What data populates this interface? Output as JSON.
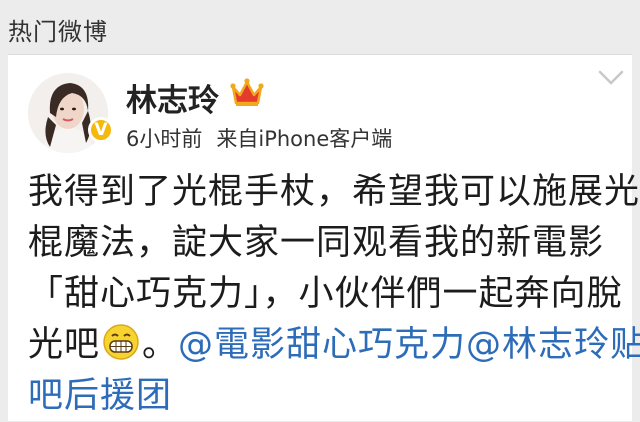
{
  "header": {
    "title": "热门微博"
  },
  "post": {
    "username": "林志玲",
    "verified_badge": "V",
    "time": "6小时前",
    "source": "来自iPhone客户端",
    "content": {
      "line1": "我得到了光棍手杖，希望我可以施展光",
      "line2": "棍魔法，諚大家一同观看我的新電影",
      "line3": "「甜心巧克力」，小伙伴們一起奔向脫",
      "line4_text": "光吧",
      "line4_after_emoji": "。",
      "mention1": "@電影甜心巧克力",
      "mention2": "@林志玲贴",
      "line5_mention_cont": "吧后援团"
    },
    "icons": {
      "crown": "crown-icon",
      "emoji": "grin-emoji-icon",
      "menu": "chevron-down-icon",
      "vip": "verified-badge-icon"
    },
    "colors": {
      "mention": "#2d6cb8",
      "badge": "#f6b80b",
      "crown": "#e53b2c"
    }
  }
}
